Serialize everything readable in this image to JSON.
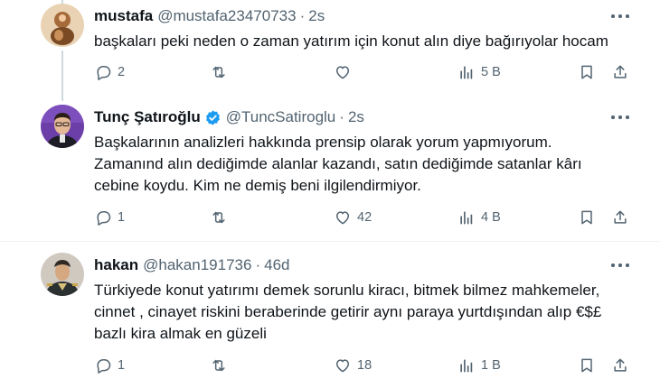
{
  "tweets": [
    {
      "name": "mustafa",
      "handle": "@mustafa23470733",
      "time": "2s",
      "verified": false,
      "lines": [
        "başkaları peki neden o zaman yatırım için konut alın diye bağırıyolar hocam"
      ],
      "replies": "2",
      "retweets": "",
      "likes": "",
      "views": "5 B"
    },
    {
      "name": "Tunç Şatıroğlu",
      "handle": "@TuncSatiroglu",
      "time": "2s",
      "verified": true,
      "lines": [
        "Başkalarının analizleri hakkında prensip olarak yorum yapmıyorum.",
        "Zamanınd alın dediğimde alanlar kazandı, satın dediğimde satanlar kârı",
        "cebine koydu. Kim ne demiş beni ilgilendirmiyor."
      ],
      "replies": "1",
      "retweets": "",
      "likes": "42",
      "views": "4 B"
    },
    {
      "name": "hakan",
      "handle": "@hakan191736",
      "time": "46d",
      "verified": false,
      "lines": [
        "Türkiyede konut yatırımı demek sorunlu kiracı, bitmek bilmez mahkemeler,",
        "cinnet , cinayet riskini beraberinde getirir aynı paraya yurtdışından alıp €$£",
        "bazlı kira almak en güzeli"
      ],
      "replies": "1",
      "retweets": "",
      "likes": "18",
      "views": "1 B"
    }
  ],
  "colors": {
    "text": "#0f1419",
    "secondary": "#536471",
    "verified_blue": "#1d9bf0",
    "thread_line": "#cfd9de",
    "divider": "#eff3f4"
  },
  "icons": [
    "reply-icon",
    "retweet-icon",
    "like-icon",
    "views-icon",
    "bookmark-icon",
    "share-icon",
    "more-icon",
    "verified-badge-icon"
  ]
}
